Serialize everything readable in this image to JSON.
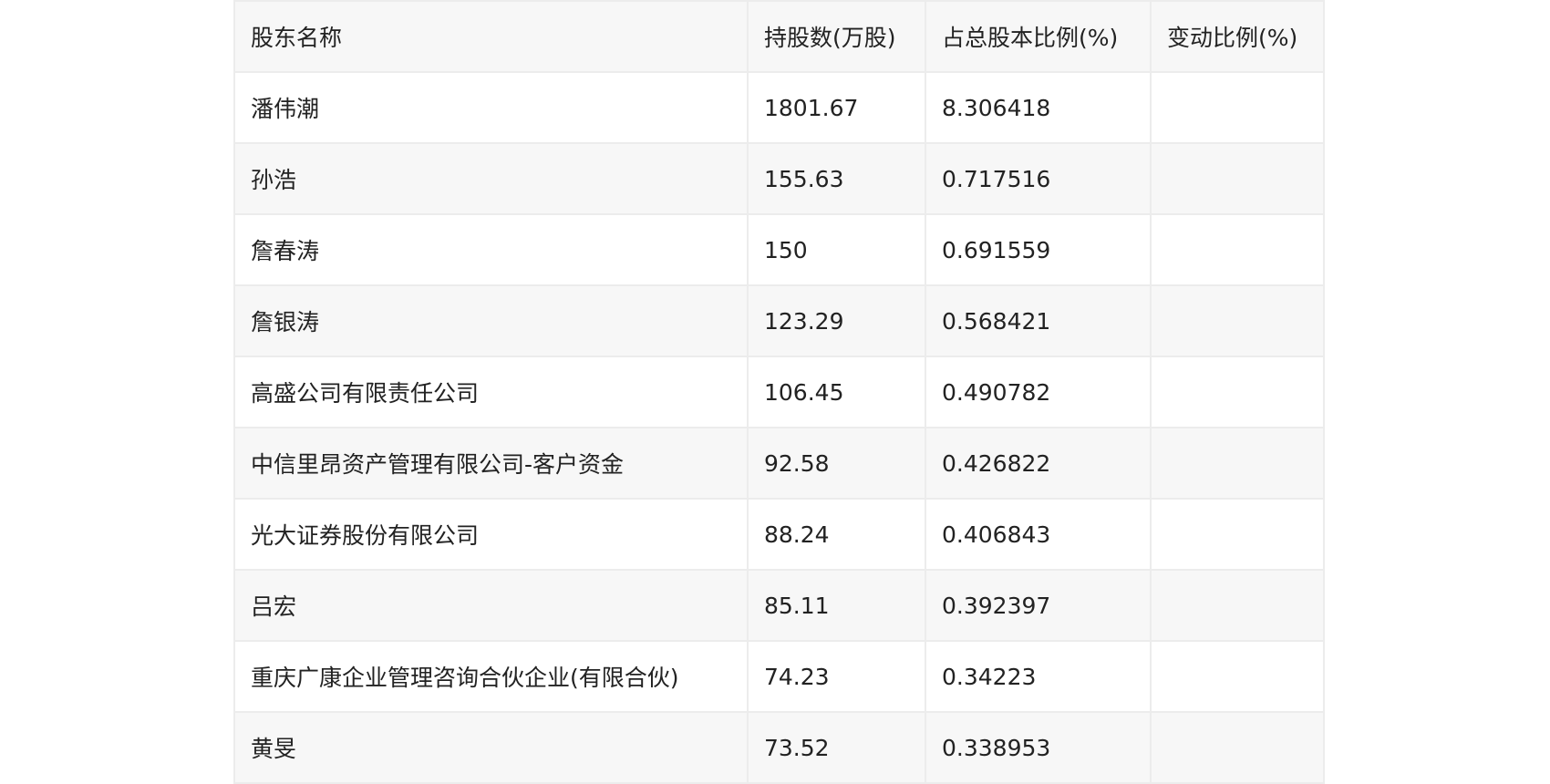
{
  "chart_data": {
    "type": "table",
    "columns": [
      "股东名称",
      "持股数(万股)",
      "占总股本比例(%)",
      "变动比例(%)"
    ],
    "rows": [
      [
        "潘伟潮",
        "1801.67",
        "8.306418",
        ""
      ],
      [
        "孙浩",
        "155.63",
        "0.717516",
        ""
      ],
      [
        "詹春涛",
        "150",
        "0.691559",
        ""
      ],
      [
        "詹银涛",
        "123.29",
        "0.568421",
        ""
      ],
      [
        "高盛公司有限责任公司",
        "106.45",
        "0.490782",
        ""
      ],
      [
        "中信里昂资产管理有限公司-客户资金",
        "92.58",
        "0.426822",
        ""
      ],
      [
        "光大证券股份有限公司",
        "88.24",
        "0.406843",
        ""
      ],
      [
        "吕宏",
        "85.11",
        "0.392397",
        ""
      ],
      [
        "重庆广康企业管理咨询合伙企业(有限合伙)",
        "74.23",
        "0.34223",
        ""
      ],
      [
        "黄旻",
        "73.52",
        "0.338953",
        ""
      ]
    ]
  }
}
